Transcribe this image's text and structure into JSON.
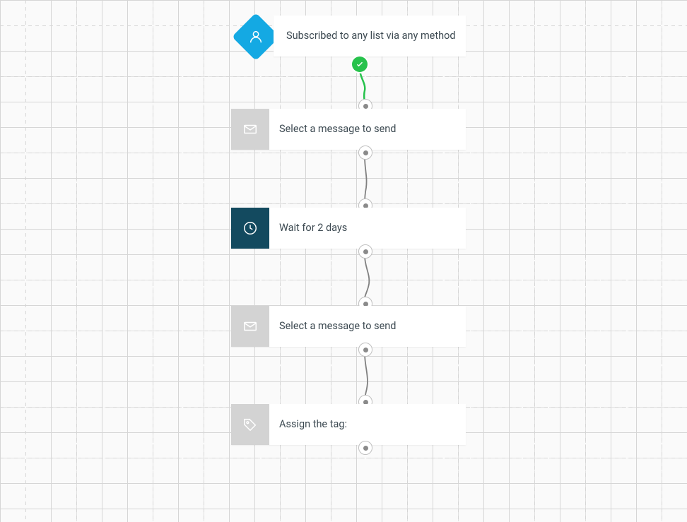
{
  "flow": {
    "trigger": {
      "label": "Subscribed to any list via any method",
      "icon": "person-icon",
      "status": "ok"
    },
    "steps": [
      {
        "type": "message",
        "label": "Select a message to send",
        "icon": "envelope-icon"
      },
      {
        "type": "wait",
        "label": "Wait for 2 days",
        "icon": "clock-icon"
      },
      {
        "type": "message",
        "label": "Select a message to send",
        "icon": "envelope-icon"
      },
      {
        "type": "tag",
        "label": "Assign the tag:",
        "icon": "tag-icon"
      }
    ]
  },
  "colors": {
    "trigger_accent": "#14a9e3",
    "wait_accent": "#134a5f",
    "success": "#27c24c",
    "placeholder_box": "#d3d3d3",
    "text": "#3d4a52"
  }
}
